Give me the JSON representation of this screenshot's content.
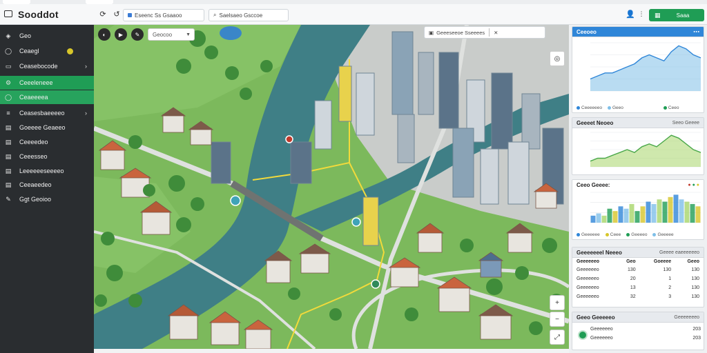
{
  "app": {
    "title": "Sooddot"
  },
  "topbar": {
    "search1": "Eseenc Ss Gsaaoo",
    "search2": "Saelsaeo  Gsccoe",
    "action_label": "Saaa"
  },
  "sidebar": {
    "items": [
      {
        "label": "Geo",
        "icon": "layers-icon"
      },
      {
        "label": "Ceaegl",
        "icon": "circle-icon"
      },
      {
        "label": "Ceasebocode",
        "icon": "folder-icon",
        "chevron": true
      },
      {
        "label": "Ceeeleneee",
        "icon": "gear-icon",
        "active": true
      },
      {
        "label": "Ceaeeeea",
        "icon": "circle-icon",
        "active": true
      },
      {
        "label": "Ceasesbaeeeeo",
        "icon": "list-icon",
        "chevron": true
      },
      {
        "label": "Goeeee Geaeeo",
        "icon": "doc-icon"
      },
      {
        "label": "Ceeeedeo",
        "icon": "doc-icon"
      },
      {
        "label": "Ceeesseo",
        "icon": "doc-icon"
      },
      {
        "label": "Leeeeeeseeeeo",
        "icon": "doc-icon"
      },
      {
        "label": "Ceeaeedeo",
        "icon": "doc-icon"
      },
      {
        "label": "Ggt Geoioo",
        "icon": "edit-icon"
      }
    ]
  },
  "map": {
    "select_label": "Geocoo",
    "search_text": "Geeeseeoe Sseeees",
    "colors": {
      "grass": "#79b65a",
      "water": "#3f7f86",
      "road": "#d9dcd8"
    }
  },
  "panels": {
    "p1": {
      "title": "Ceeoeo",
      "sub": "",
      "legend": [
        "Ceeeeeeo",
        "Geeo",
        "Ceeo"
      ]
    },
    "p2": {
      "title": "Geeeet Neoeo",
      "sub": "Seeo Geeee"
    },
    "p3": {
      "title": "Ceeo Geeee:",
      "legend": [
        "Geeeeee",
        "Ceee",
        "Geeeeo",
        "Geeeee"
      ]
    },
    "p4": {
      "title": "Geeeeeeel Neeeo",
      "sub": "Geeee eaeeeeeeo",
      "headers": [
        "Geeeeeeo",
        "Geo",
        "Goeeee",
        "Geeo"
      ],
      "rows": [
        [
          "Geeeeeeo",
          "130",
          "130",
          "130"
        ],
        [
          "Geeeeeeo",
          "20",
          "1",
          "130"
        ],
        [
          "Geeeeeeo",
          "13",
          "2",
          "130"
        ],
        [
          "Geeeeeeo",
          "32",
          "3",
          "130"
        ]
      ]
    },
    "p5": {
      "title": "Geeo Geeeeeo",
      "sub": "Geeeeeeeo",
      "rows": [
        [
          "Geeeeeeo",
          "203"
        ],
        [
          "Geeeeeeo",
          "203"
        ]
      ]
    }
  },
  "chart_data": [
    {
      "type": "area",
      "x": [
        0,
        1,
        2,
        3,
        4,
        5,
        6,
        7,
        8,
        9,
        10,
        11,
        12,
        13,
        14,
        15
      ],
      "values": [
        4,
        5,
        6,
        6,
        7,
        8,
        9,
        11,
        12,
        11,
        10,
        13,
        15,
        14,
        12,
        11
      ],
      "ylim": [
        0,
        16
      ]
    },
    {
      "type": "area",
      "x": [
        0,
        1,
        2,
        3,
        4,
        5,
        6,
        7,
        8,
        9,
        10,
        11,
        12,
        13,
        14,
        15
      ],
      "values": [
        2,
        3,
        3,
        4,
        5,
        6,
        5,
        7,
        8,
        7,
        9,
        11,
        10,
        8,
        6,
        5
      ],
      "ylim": [
        0,
        12
      ]
    },
    {
      "type": "bar",
      "x": [
        0,
        1,
        2,
        3,
        4,
        5,
        6,
        7,
        8,
        9,
        10,
        11,
        12,
        13,
        14,
        15,
        16,
        17,
        18,
        19
      ],
      "values": [
        3,
        4,
        3,
        6,
        5,
        7,
        6,
        8,
        5,
        7,
        9,
        8,
        10,
        9,
        11,
        12,
        10,
        9,
        8,
        7
      ],
      "ylim": [
        0,
        13
      ]
    }
  ]
}
